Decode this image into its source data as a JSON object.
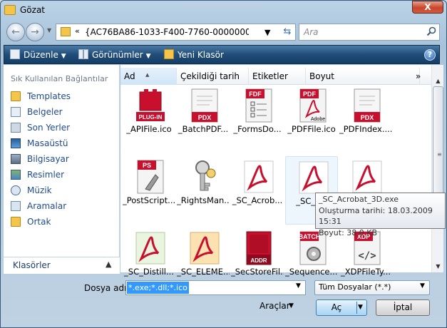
{
  "window": {
    "title": "Gözat",
    "close_label": "X"
  },
  "address": {
    "path": "{AC76BA86-1033-F400-7760-00000000000...",
    "separator": "«",
    "search_placeholder": "Ara"
  },
  "toolbar": {
    "organize": "Düzenle",
    "views": "Görünümler",
    "new_folder": "Yeni Klasör",
    "help": "?"
  },
  "sidebar": {
    "heading": "Sık Kullanılan Bağlantılar",
    "items": [
      {
        "label": "Templates",
        "icon": "folder-icon"
      },
      {
        "label": "Belgeler",
        "icon": "documents-icon"
      },
      {
        "label": "Son Yerler",
        "icon": "recent-places-icon"
      },
      {
        "label": "Masaüstü",
        "icon": "desktop-icon"
      },
      {
        "label": "Bilgisayar",
        "icon": "computer-icon"
      },
      {
        "label": "Resimler",
        "icon": "pictures-icon"
      },
      {
        "label": "Müzik",
        "icon": "music-icon"
      },
      {
        "label": "Aramalar",
        "icon": "searches-icon"
      },
      {
        "label": "Ortak",
        "icon": "folder-icon"
      }
    ],
    "folders_label": "Klasörler"
  },
  "columns": [
    "Ad",
    "Çekildiği tarih",
    "Etiketler",
    "Boyut"
  ],
  "files": [
    {
      "name": "_APIFile.ico",
      "icon": "plugin-icon",
      "badge": "PLUG-IN"
    },
    {
      "name": "_BatchPDF...",
      "icon": "pdx-document-icon",
      "badge": "PDX"
    },
    {
      "name": "_FormsDo...",
      "icon": "fdf-form-icon",
      "badge": "FDF"
    },
    {
      "name": "_PDFFile.ico",
      "icon": "pdf-adobe-icon",
      "badge": "PDF",
      "badge2": "Adobe"
    },
    {
      "name": "_PDFIndex....",
      "icon": "pdx-index-icon",
      "badge": "PDX"
    },
    {
      "name": "_PostScript....",
      "icon": "postscript-icon",
      "badge": "PS"
    },
    {
      "name": "_RightsMan...",
      "icon": "rights-manager-keys-icon",
      "badge": ""
    },
    {
      "name": "_SC_Acrob...",
      "icon": "acrobat-logo-icon",
      "badge": ""
    },
    {
      "name": "_SC_Acr",
      "icon": "acrobat-logo-icon",
      "badge": ""
    },
    {
      "name": "",
      "icon": "acrobat-logo-icon",
      "badge": ""
    },
    {
      "name": "_SC_Distill...",
      "icon": "acrobat-distiller-icon",
      "badge": ""
    },
    {
      "name": "_SC_ELEME...",
      "icon": "acrobat-elements-icon",
      "badge": ""
    },
    {
      "name": "_SecStoreFil...",
      "icon": "addr-book-icon",
      "badge": "ADDR"
    },
    {
      "name": "_Sequence....",
      "icon": "batch-gear-icon",
      "badge": "BATCH"
    },
    {
      "name": "_XDPFileTy...",
      "icon": "xdp-code-icon",
      "badge": "XDP"
    }
  ],
  "tooltip": {
    "line1": "_SC_Acrobat_3D.exe",
    "line2": "Oluşturma tarihi: 18.03.2009 15:31",
    "line3": "Boyut: 38,0 KB"
  },
  "bottom": {
    "filename_label": "Dosya adı:",
    "filename_value": "*.exe;*.dll;*.ico",
    "filter_value": "Tüm Dosyalar (*.*)",
    "tools_label": "Araçlar",
    "open_label": "Aç",
    "cancel_label": "İptal"
  },
  "colors": {
    "toolbar": "#204d78",
    "acrobat_red": "#c8102e",
    "selection": "#3399ff"
  }
}
